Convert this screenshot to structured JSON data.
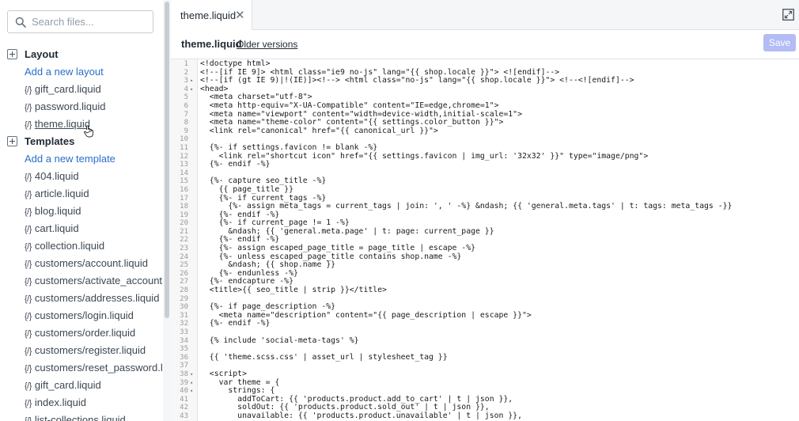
{
  "sidebar": {
    "search_placeholder": "Search files...",
    "layout": {
      "title": "Layout",
      "add_label": "Add a new layout",
      "files": [
        "gift_card.liquid",
        "password.liquid",
        "theme.liquid"
      ]
    },
    "templates": {
      "title": "Templates",
      "add_label": "Add a new template",
      "files": [
        "404.liquid",
        "article.liquid",
        "blog.liquid",
        "cart.liquid",
        "collection.liquid",
        "customers/account.liquid",
        "customers/activate_account.liquid",
        "customers/addresses.liquid",
        "customers/login.liquid",
        "customers/order.liquid",
        "customers/register.liquid",
        "customers/reset_password.liquid",
        "gift_card.liquid",
        "index.liquid",
        "list-collections.liquid"
      ]
    },
    "file_icon": "{/}"
  },
  "tab": {
    "label": "theme.liquid",
    "close": "✕"
  },
  "file_header": {
    "name": "theme.liquid",
    "older_versions": "Older versions",
    "save_label": "Save"
  },
  "code_lines": [
    {
      "n": "1",
      "fold": "",
      "text": "<!doctype html>"
    },
    {
      "n": "2",
      "fold": "",
      "text": "<!--[if IE 9]> <html class=\"ie9 no-js\" lang=\"{{ shop.locale }}\"> <![endif]-->"
    },
    {
      "n": "3",
      "fold": "▾",
      "text": "<!--[if (gt IE 9)|!(IE)]><!--> <html class=\"no-js\" lang=\"{{ shop.locale }}\"> <!--<![endif]-->"
    },
    {
      "n": "4",
      "fold": "▾",
      "text": "<head>"
    },
    {
      "n": "5",
      "fold": "",
      "text": "  <meta charset=\"utf-8\">"
    },
    {
      "n": "6",
      "fold": "",
      "text": "  <meta http-equiv=\"X-UA-Compatible\" content=\"IE=edge,chrome=1\">"
    },
    {
      "n": "7",
      "fold": "",
      "text": "  <meta name=\"viewport\" content=\"width=device-width,initial-scale=1\">"
    },
    {
      "n": "8",
      "fold": "",
      "text": "  <meta name=\"theme-color\" content=\"{{ settings.color_button }}\">"
    },
    {
      "n": "9",
      "fold": "",
      "text": "  <link rel=\"canonical\" href=\"{{ canonical_url }}\">"
    },
    {
      "n": "10",
      "fold": "",
      "text": ""
    },
    {
      "n": "11",
      "fold": "",
      "text": "  {%- if settings.favicon != blank -%}"
    },
    {
      "n": "12",
      "fold": "",
      "text": "    <link rel=\"shortcut icon\" href=\"{{ settings.favicon | img_url: '32x32' }}\" type=\"image/png\">"
    },
    {
      "n": "13",
      "fold": "",
      "text": "  {%- endif -%}"
    },
    {
      "n": "14",
      "fold": "",
      "text": ""
    },
    {
      "n": "15",
      "fold": "",
      "text": "  {%- capture seo_title -%}"
    },
    {
      "n": "16",
      "fold": "",
      "text": "    {{ page_title }}"
    },
    {
      "n": "17",
      "fold": "",
      "text": "    {%- if current_tags -%}"
    },
    {
      "n": "18",
      "fold": "",
      "text": "      {%- assign meta_tags = current_tags | join: ', ' -%} &ndash; {{ 'general.meta.tags' | t: tags: meta_tags -}}"
    },
    {
      "n": "19",
      "fold": "",
      "text": "    {%- endif -%}"
    },
    {
      "n": "20",
      "fold": "",
      "text": "    {%- if current_page != 1 -%}"
    },
    {
      "n": "21",
      "fold": "",
      "text": "      &ndash; {{ 'general.meta.page' | t: page: current_page }}"
    },
    {
      "n": "22",
      "fold": "",
      "text": "    {%- endif -%}"
    },
    {
      "n": "23",
      "fold": "",
      "text": "    {%- assign escaped_page_title = page_title | escape -%}"
    },
    {
      "n": "24",
      "fold": "",
      "text": "    {%- unless escaped_page_title contains shop.name -%}"
    },
    {
      "n": "25",
      "fold": "",
      "text": "      &ndash; {{ shop.name }}"
    },
    {
      "n": "26",
      "fold": "",
      "text": "    {%- endunless -%}"
    },
    {
      "n": "27",
      "fold": "",
      "text": "  {%- endcapture -%}"
    },
    {
      "n": "28",
      "fold": "",
      "text": "  <title>{{ seo_title | strip }}</title>"
    },
    {
      "n": "29",
      "fold": "",
      "text": ""
    },
    {
      "n": "30",
      "fold": "",
      "text": "  {%- if page_description -%}"
    },
    {
      "n": "31",
      "fold": "",
      "text": "    <meta name=\"description\" content=\"{{ page_description | escape }}\">"
    },
    {
      "n": "32",
      "fold": "",
      "text": "  {%- endif -%}"
    },
    {
      "n": "33",
      "fold": "",
      "text": ""
    },
    {
      "n": "34",
      "fold": "",
      "text": "  {% include 'social-meta-tags' %}"
    },
    {
      "n": "35",
      "fold": "",
      "text": ""
    },
    {
      "n": "36",
      "fold": "",
      "text": "  {{ 'theme.scss.css' | asset_url | stylesheet_tag }}"
    },
    {
      "n": "37",
      "fold": "",
      "text": ""
    },
    {
      "n": "38",
      "fold": "▾",
      "text": "  <script>"
    },
    {
      "n": "39",
      "fold": "▾",
      "text": "    var theme = {"
    },
    {
      "n": "40",
      "fold": "▾",
      "text": "      strings: {"
    },
    {
      "n": "41",
      "fold": "",
      "text": "        addToCart: {{ 'products.product.add_to_cart' | t | json }},"
    },
    {
      "n": "42",
      "fold": "",
      "text": "        soldOut: {{ 'products.product.sold_out' | t | json }},"
    },
    {
      "n": "43",
      "fold": "",
      "text": "        unavailable: {{ 'products.product.unavailable' | t | json }},"
    }
  ]
}
